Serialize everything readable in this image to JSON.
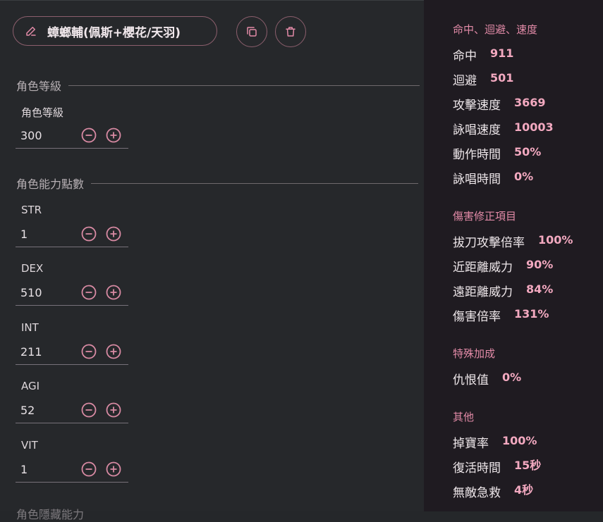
{
  "header": {
    "character_name": "蟑螂輔(佩斯+櫻花/天羽)",
    "icons": {
      "edit": "pencil-icon",
      "copy": "copy-icon",
      "delete": "trash-icon"
    }
  },
  "sections": {
    "level_title": "角色等級",
    "stats_title": "角色能力點數",
    "next_title_partial": "角色隱藏能力"
  },
  "fields": [
    {
      "label": "角色等級",
      "value": "300"
    },
    {
      "label": "STR",
      "value": "1"
    },
    {
      "label": "DEX",
      "value": "510"
    },
    {
      "label": "INT",
      "value": "211"
    },
    {
      "label": "AGI",
      "value": "52"
    },
    {
      "label": "VIT",
      "value": "1"
    }
  ],
  "stats_panel": {
    "groups": [
      {
        "title": "命中、迴避、速度",
        "items": [
          {
            "k": "命中",
            "v": "911"
          },
          {
            "k": "迴避",
            "v": "501"
          },
          {
            "k": "攻擊速度",
            "v": "3669"
          },
          {
            "k": "詠唱速度",
            "v": "10003"
          },
          {
            "k": "動作時間",
            "v": "50%"
          },
          {
            "k": "詠唱時間",
            "v": "0%"
          }
        ]
      },
      {
        "title": "傷害修正項目",
        "items": [
          {
            "k": "拔刀攻擊倍率",
            "v": "100%"
          },
          {
            "k": "近距離威力",
            "v": "90%"
          },
          {
            "k": "遠距離威力",
            "v": "84%"
          },
          {
            "k": "傷害倍率",
            "v": "131%"
          }
        ]
      },
      {
        "title": "特殊加成",
        "items": [
          {
            "k": "仇恨值",
            "v": "0%"
          }
        ]
      },
      {
        "title": "其他",
        "items": [
          {
            "k": "掉寶率",
            "v": "100%"
          },
          {
            "k": "復活時間",
            "v": "15秒"
          },
          {
            "k": "無敵急救",
            "v": "4秒"
          }
        ]
      }
    ]
  },
  "colors": {
    "accent": "#e38ba8",
    "value": "#f3a9c0",
    "border": "#8c5f6d",
    "panel": "#1f1b21"
  }
}
